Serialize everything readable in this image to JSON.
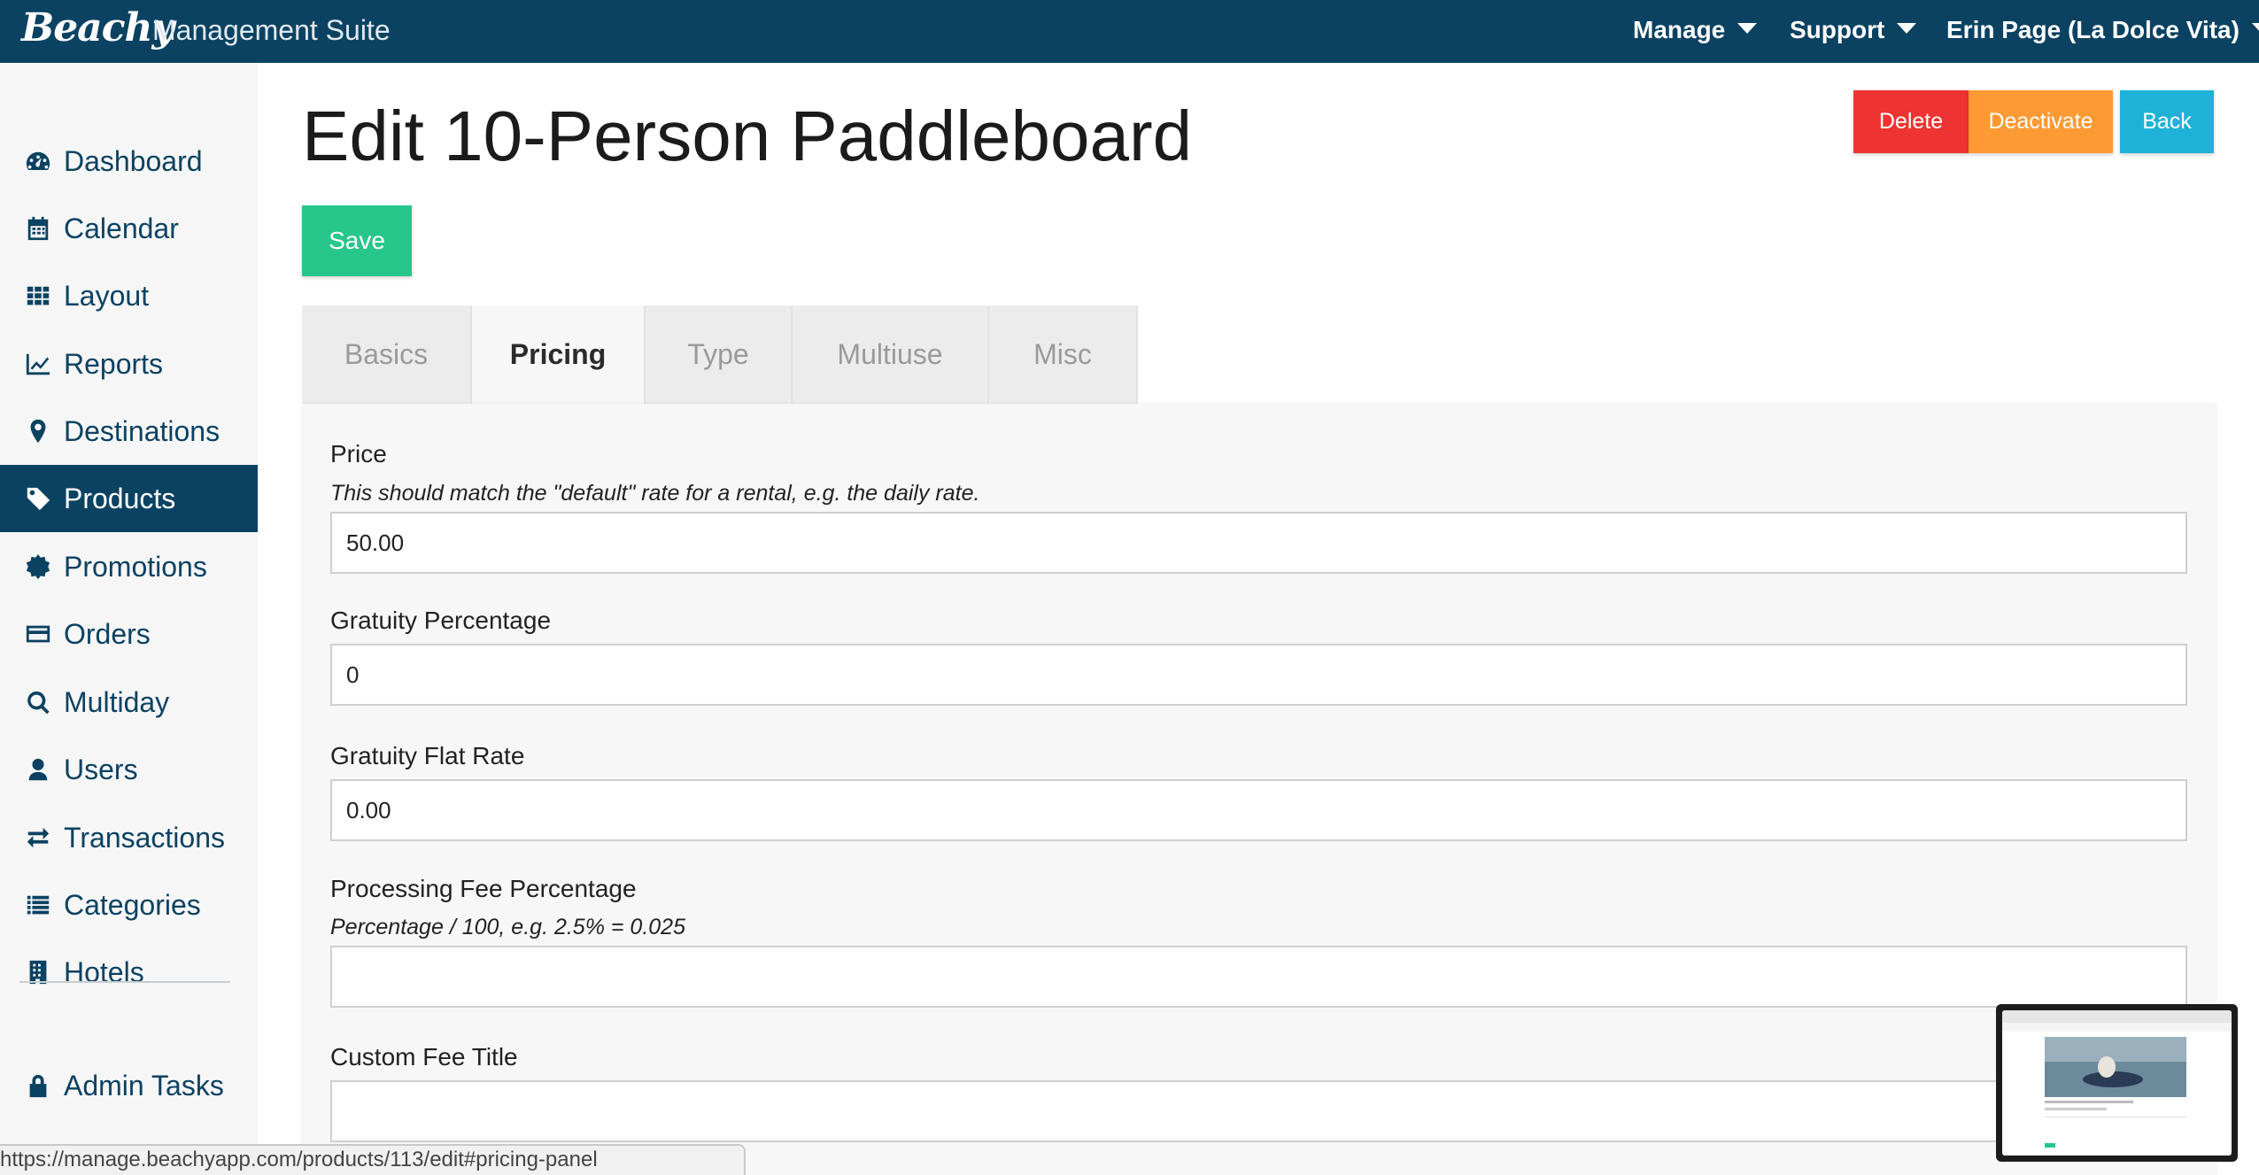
{
  "topbar": {
    "logo": "Beachy",
    "suite": "Management Suite",
    "menus": [
      {
        "label": "Manage"
      },
      {
        "label": "Support"
      },
      {
        "label": "Erin Page (La Dolce Vita)"
      }
    ]
  },
  "sidebar": {
    "items": [
      {
        "label": "Dashboard",
        "icon": "dashboard-icon"
      },
      {
        "label": "Calendar",
        "icon": "calendar-icon"
      },
      {
        "label": "Layout",
        "icon": "grid-icon"
      },
      {
        "label": "Reports",
        "icon": "line-chart-icon"
      },
      {
        "label": "Destinations",
        "icon": "map-marker-icon"
      },
      {
        "label": "Products",
        "icon": "tag-icon",
        "active": true
      },
      {
        "label": "Promotions",
        "icon": "badge-icon"
      },
      {
        "label": "Orders",
        "icon": "credit-card-icon"
      },
      {
        "label": "Multiday",
        "icon": "search-icon"
      },
      {
        "label": "Users",
        "icon": "user-icon"
      },
      {
        "label": "Transactions",
        "icon": "exchange-icon"
      },
      {
        "label": "Categories",
        "icon": "list-icon"
      },
      {
        "label": "Hotels",
        "icon": "building-icon"
      }
    ],
    "admin": {
      "label": "Admin Tasks",
      "icon": "lock-icon"
    }
  },
  "page": {
    "title": "Edit 10-Person Paddleboard",
    "buttons": {
      "delete": "Delete",
      "deactivate": "Deactivate",
      "back": "Back",
      "save": "Save"
    }
  },
  "tabs": [
    {
      "label": "Basics"
    },
    {
      "label": "Pricing",
      "active": true
    },
    {
      "label": "Type"
    },
    {
      "label": "Multiuse"
    },
    {
      "label": "Misc"
    }
  ],
  "form": {
    "price": {
      "label": "Price",
      "help": "This should match the \"default\" rate for a rental, e.g. the daily rate.",
      "value": "50.00"
    },
    "gratuity_percentage": {
      "label": "Gratuity Percentage",
      "value": "0"
    },
    "gratuity_flat_rate": {
      "label": "Gratuity Flat Rate",
      "value": "0.00"
    },
    "processing_fee": {
      "label": "Processing Fee Percentage",
      "help": "Percentage / 100, e.g. 2.5% = 0.025",
      "value": ""
    },
    "custom_fee_title": {
      "label": "Custom Fee Title",
      "value": ""
    }
  },
  "statusbar": {
    "url": "https://manage.beachyapp.com/products/113/edit#pricing-panel"
  },
  "colors": {
    "brand": "#0b4262",
    "delete": "#ee3432",
    "deactivate": "#fd9a34",
    "back": "#1fb2d8",
    "save": "#27c78b"
  }
}
